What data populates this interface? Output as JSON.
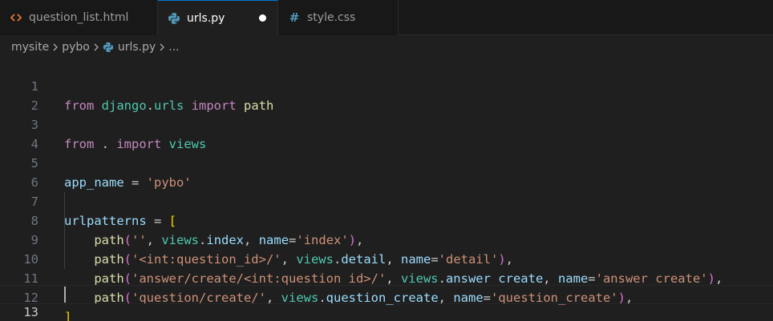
{
  "tabs": [
    {
      "label": "question_list.html",
      "icon": "html-icon",
      "active": false
    },
    {
      "label": "urls.py",
      "icon": "python-icon",
      "active": true,
      "modified": true
    },
    {
      "label": "style.css",
      "icon": "css-icon",
      "active": false
    }
  ],
  "breadcrumb": {
    "items": [
      "mysite",
      "pybo",
      "urls.py",
      "..."
    ]
  },
  "editor": {
    "line_numbers": [
      "1",
      "2",
      "3",
      "4",
      "5",
      "6",
      "7",
      "8",
      "9",
      "10",
      "11",
      "12",
      "13"
    ],
    "active_line": "13",
    "lines": {
      "l1": {
        "kw1": "from",
        "sp1": " ",
        "mod1": "django",
        "dot": ".",
        "mod2": "urls",
        "sp2": " ",
        "kw2": "import",
        "sp3": " ",
        "fn": "path"
      },
      "l3": {
        "kw1": "from",
        "sp1": " . ",
        "kw2": "import",
        "sp2": " ",
        "mod": "views"
      },
      "l5": {
        "var": "app_name",
        "op": " = ",
        "str": "'pybo'"
      },
      "l7": {
        "var": "urlpatterns",
        "op": " = ",
        "br": "["
      },
      "l8": {
        "indent": "    ",
        "fn": "path",
        "open": "(",
        "str1": "''",
        "p1": ", ",
        "mod": "views",
        "dot": ".",
        "attr": "index",
        "p2": ", ",
        "kwarg": "name",
        "eq": "=",
        "str2": "'index'",
        "close": ")",
        "end": ","
      },
      "l9": {
        "indent": "    ",
        "fn": "path",
        "open": "(",
        "str1": "'<int:question_id>/'",
        "p1": ", ",
        "mod": "views",
        "dot": ".",
        "attr": "detail",
        "p2": ", ",
        "kwarg": "name",
        "eq": "=",
        "str2": "'detail'",
        "close": ")",
        "end": ","
      },
      "l10": {
        "indent": "    ",
        "fn": "path",
        "open": "(",
        "str1": "'answer/create/<int:question_id>/'",
        "p1": ", ",
        "mod": "views",
        "dot": ".",
        "attr": "answer_create",
        "p2": ", ",
        "kwarg": "name",
        "eq": "=",
        "str2": "'answer_create'",
        "close": ")",
        "end": ","
      },
      "l11": {
        "indent": "    ",
        "fn": "path",
        "open": "(",
        "str1": "'question/create/'",
        "p1": ", ",
        "mod": "views",
        "dot": ".",
        "attr": "question_create",
        "p2": ", ",
        "kwarg": "name",
        "eq": "=",
        "str2": "'question_create'",
        "close": ")",
        "end": ","
      },
      "l12": {
        "br": "]"
      }
    }
  },
  "colors": {
    "background": "#1f1f1f",
    "tab_bar": "#181818",
    "keyword": "#c586c0",
    "module": "#4ec9b0",
    "function": "#dcdcaa",
    "variable": "#9cdcfe",
    "string": "#ce9178",
    "bracket_level1": "#ffd700",
    "bracket_level2": "#da70d6"
  }
}
